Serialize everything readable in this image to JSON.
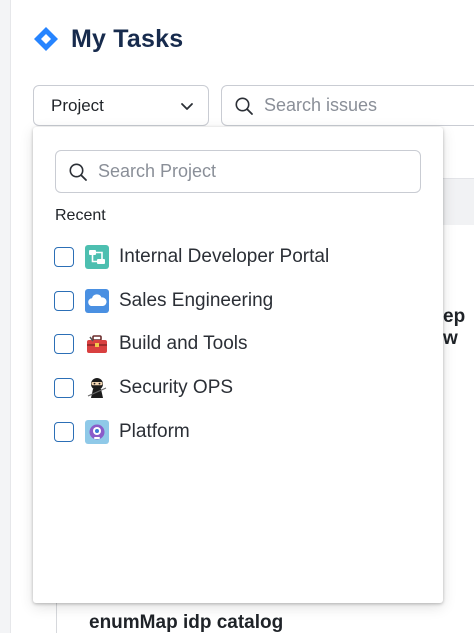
{
  "header": {
    "title": "My Tasks",
    "logo_icon": "jira-diamond-icon",
    "brand_color": "#2684ff"
  },
  "filters": {
    "project_select": {
      "label": "Project",
      "icon": "chevron-down-icon"
    },
    "search_issues": {
      "placeholder": "Search issues",
      "icon": "search-icon"
    }
  },
  "dropdown": {
    "search": {
      "placeholder": "Search Project",
      "icon": "search-icon"
    },
    "section_label": "Recent",
    "options": [
      {
        "label": "Internal Developer Portal",
        "icon": "portal-icon",
        "checked": false
      },
      {
        "label": "Sales Engineering",
        "icon": "cloud-icon",
        "checked": false
      },
      {
        "label": "Build and Tools",
        "icon": "toolbox-icon",
        "checked": false
      },
      {
        "label": "Security OPS",
        "icon": "ninja-icon",
        "checked": false
      },
      {
        "label": "Platform",
        "icon": "robot-icon",
        "checked": false
      }
    ]
  },
  "background": {
    "card_fragment": "ep w",
    "bottom_title": "enumMap idp catalog"
  }
}
